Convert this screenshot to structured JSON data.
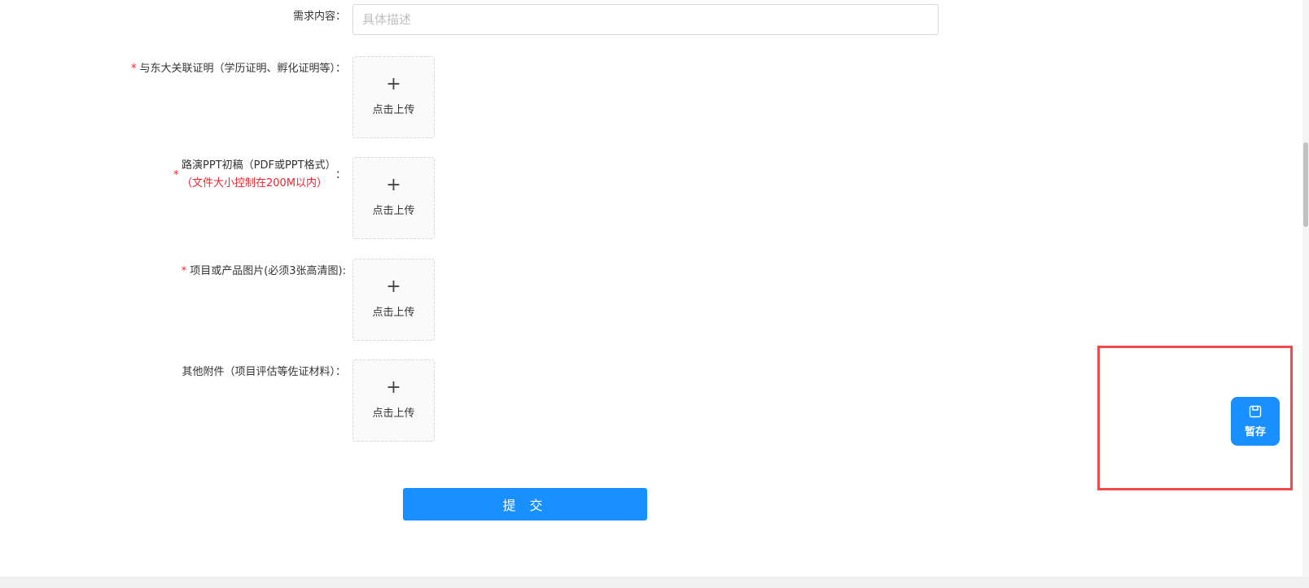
{
  "form": {
    "requirement": {
      "label": "需求内容：",
      "placeholder": "具体描述",
      "value": ""
    },
    "association_proof": {
      "required_mark": "*",
      "label": "与东大关联证明（学历证明、孵化证明等）："
    },
    "roadshow_ppt": {
      "required_mark": "*",
      "label_line1": "路演PPT初稿（PDF或PPT格式）",
      "label_line2": "（文件大小控制在200M以内）",
      "colon": "："
    },
    "product_images": {
      "required_mark": "*",
      "label": "项目或产品图片(必须3张高清图):"
    },
    "other_attachments": {
      "label": "其他附件（项目评估等佐证材料）："
    },
    "upload": {
      "plus": "+",
      "text": "点击上传"
    },
    "submit_label": "提 交"
  },
  "floating": {
    "save_label": "暂存",
    "save_icon": "save-icon"
  },
  "colors": {
    "primary": "#1890ff",
    "required": "#f5222d",
    "highlight": "#ef4b4b"
  }
}
